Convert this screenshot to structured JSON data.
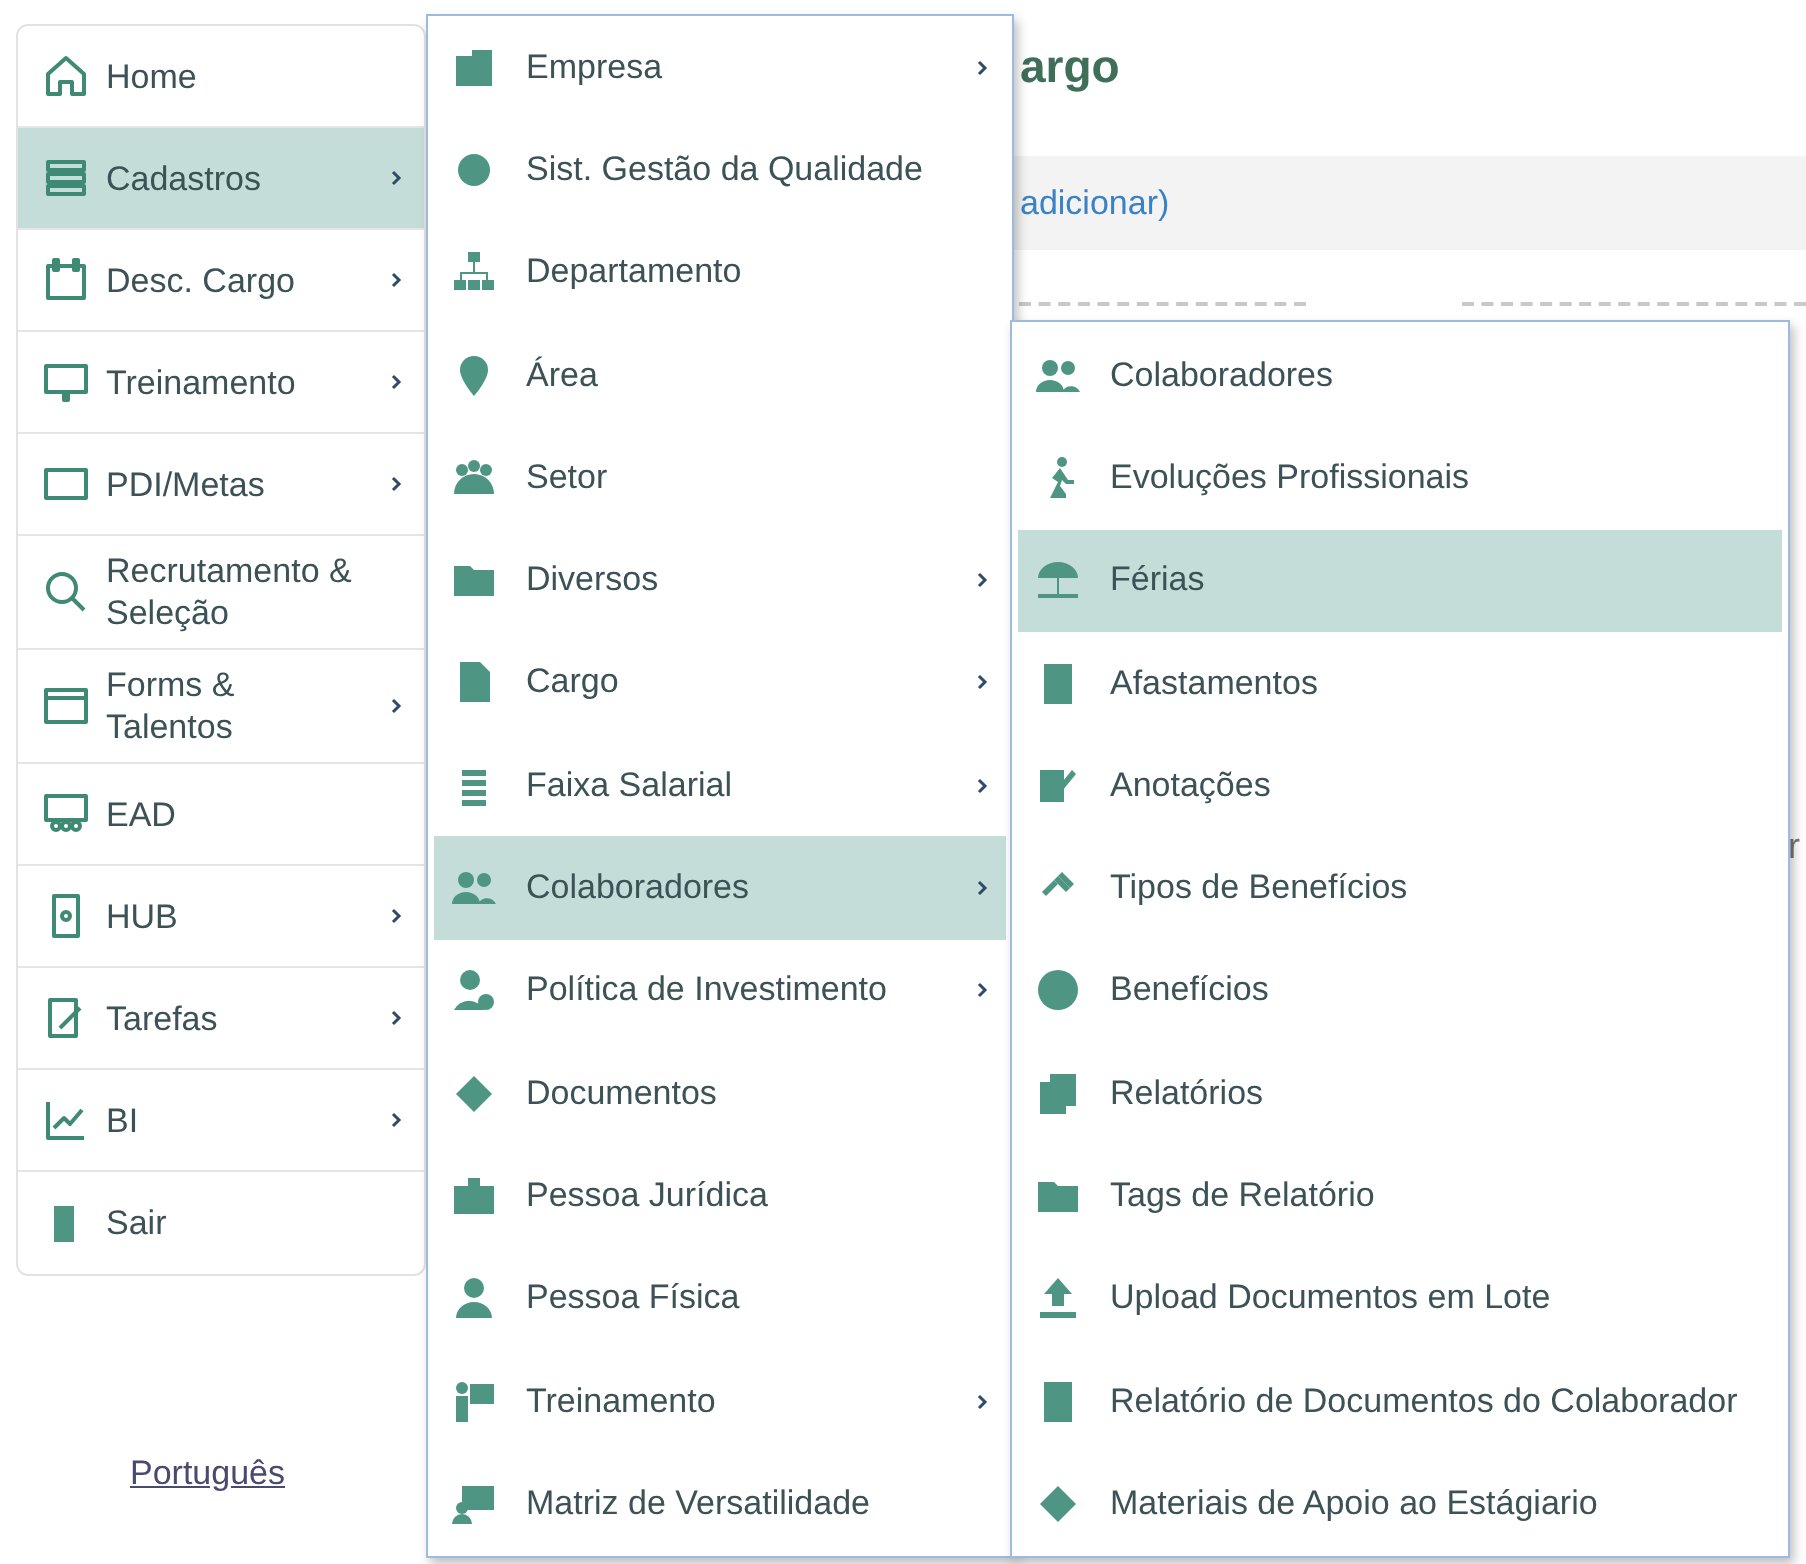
{
  "sidebar": {
    "items": [
      {
        "label": "Home",
        "selected": false,
        "has_submenu": false
      },
      {
        "label": "Cadastros",
        "selected": true,
        "has_submenu": true
      },
      {
        "label": "Desc. Cargo",
        "selected": false,
        "has_submenu": true
      },
      {
        "label": "Treinamento",
        "selected": false,
        "has_submenu": true
      },
      {
        "label": "PDI/Metas",
        "selected": false,
        "has_submenu": true
      },
      {
        "label": "Recrutamento & Seleção",
        "selected": false,
        "has_submenu": false
      },
      {
        "label": "Forms & Talentos",
        "selected": false,
        "has_submenu": true
      },
      {
        "label": "EAD",
        "selected": false,
        "has_submenu": false
      },
      {
        "label": "HUB",
        "selected": false,
        "has_submenu": true
      },
      {
        "label": "Tarefas",
        "selected": false,
        "has_submenu": true
      },
      {
        "label": "BI",
        "selected": false,
        "has_submenu": true
      },
      {
        "label": "Sair",
        "selected": false,
        "has_submenu": false
      }
    ]
  },
  "language_link": "Português",
  "page": {
    "title": "argo",
    "hint_link": "adicionar)",
    "right_fragment": "r"
  },
  "cadastros_menu": {
    "items": [
      {
        "label": "Empresa",
        "selected": false,
        "has_submenu": true
      },
      {
        "label": "Sist. Gestão da Qualidade",
        "selected": false,
        "has_submenu": false
      },
      {
        "label": "Departamento",
        "selected": false,
        "has_submenu": false
      },
      {
        "label": "Área",
        "selected": false,
        "has_submenu": false
      },
      {
        "label": "Setor",
        "selected": false,
        "has_submenu": false
      },
      {
        "label": "Diversos",
        "selected": false,
        "has_submenu": true
      },
      {
        "label": "Cargo",
        "selected": false,
        "has_submenu": true
      },
      {
        "label": "Faixa Salarial",
        "selected": false,
        "has_submenu": true
      },
      {
        "label": "Colaboradores",
        "selected": true,
        "has_submenu": true
      },
      {
        "label": "Política de Investimento",
        "selected": false,
        "has_submenu": true
      },
      {
        "label": "Documentos",
        "selected": false,
        "has_submenu": false
      },
      {
        "label": "Pessoa Jurídica",
        "selected": false,
        "has_submenu": false
      },
      {
        "label": "Pessoa Física",
        "selected": false,
        "has_submenu": false
      },
      {
        "label": "Treinamento",
        "selected": false,
        "has_submenu": true
      },
      {
        "label": "Matriz de Versatilidade",
        "selected": false,
        "has_submenu": false
      }
    ]
  },
  "colaboradores_menu": {
    "items": [
      {
        "label": "Colaboradores",
        "selected": false
      },
      {
        "label": "Evoluções Profissionais",
        "selected": false
      },
      {
        "label": "Férias",
        "selected": true
      },
      {
        "label": "Afastamentos",
        "selected": false
      },
      {
        "label": "Anotações",
        "selected": false
      },
      {
        "label": "Tipos de Benefícios",
        "selected": false
      },
      {
        "label": "Benefícios",
        "selected": false
      },
      {
        "label": "Relatórios",
        "selected": false
      },
      {
        "label": "Tags de Relatório",
        "selected": false
      },
      {
        "label": "Upload Documentos em Lote",
        "selected": false
      },
      {
        "label": "Relatório de Documentos do Colaborador",
        "selected": false
      },
      {
        "label": "Materiais de Apoio ao Estágiario",
        "selected": false
      }
    ]
  }
}
